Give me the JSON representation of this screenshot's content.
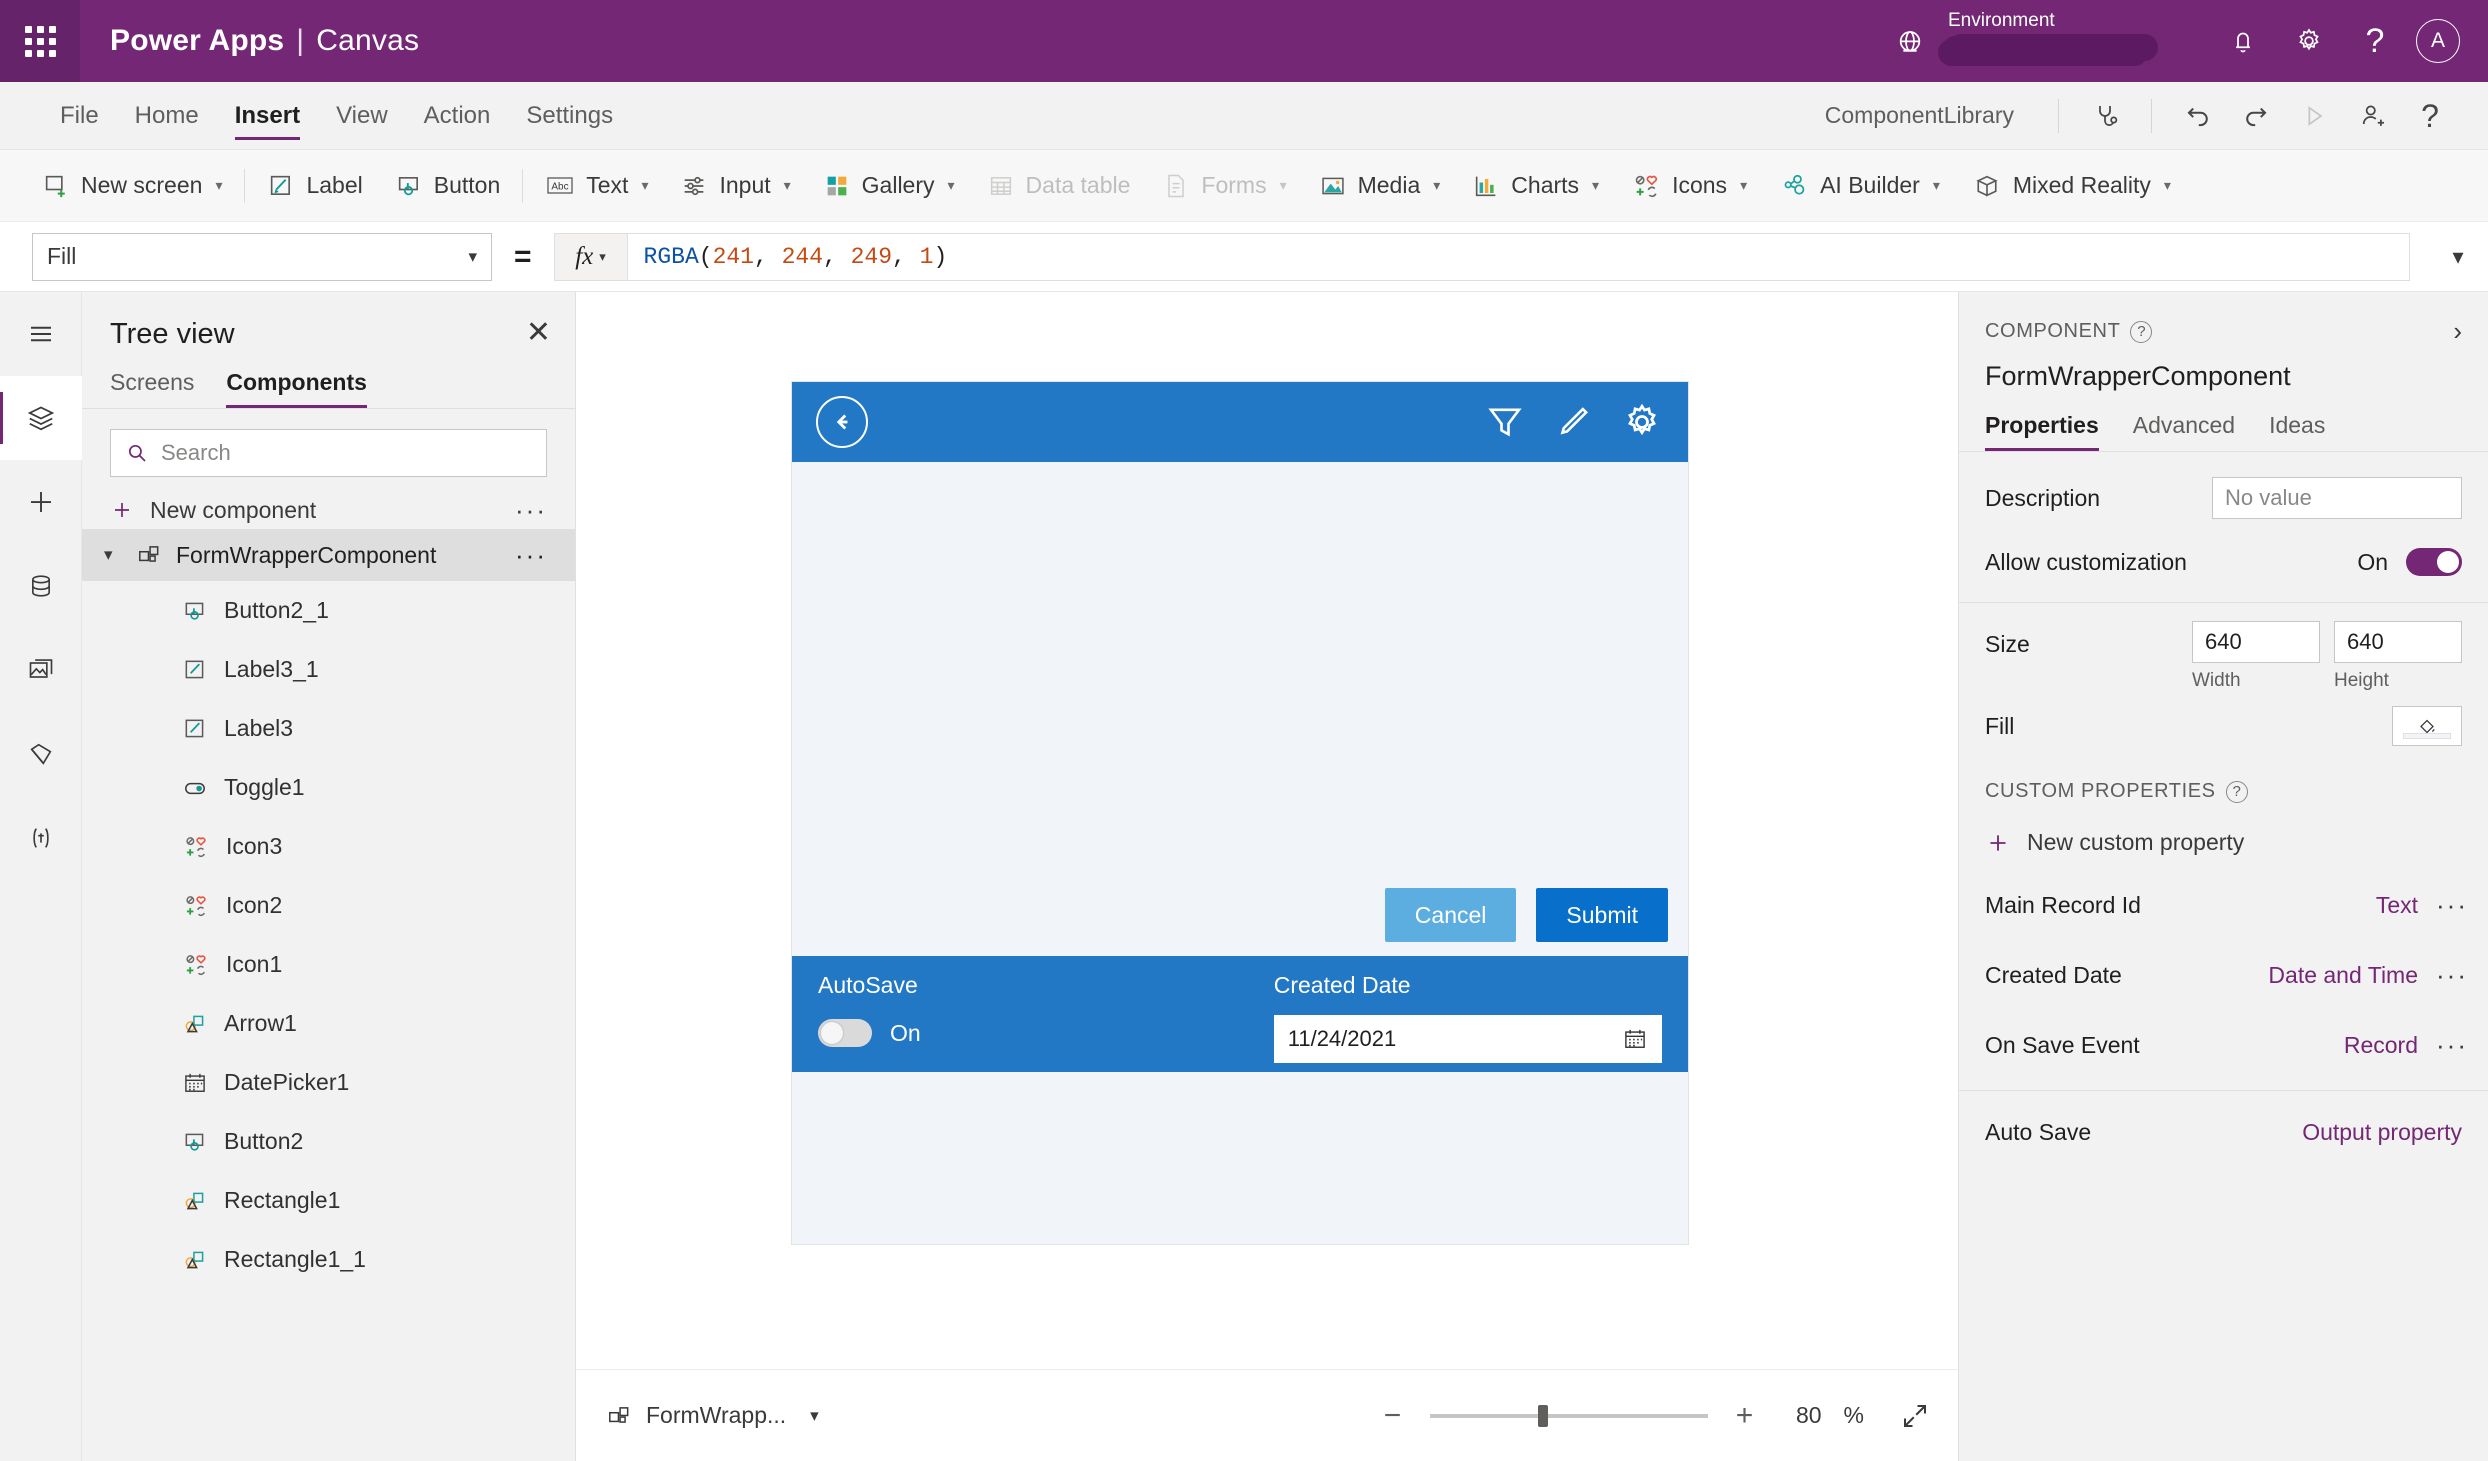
{
  "topbar": {
    "waffle_label": "app-launcher",
    "brand": "Power Apps",
    "separator": "|",
    "sub_brand": "Canvas",
    "environment_label": "Environment",
    "environment_value": "",
    "avatar_initial": "A",
    "icons": [
      "globe-icon",
      "bell-icon",
      "gear-icon",
      "help-icon"
    ]
  },
  "menubar": {
    "items": [
      {
        "label": "File",
        "active": false
      },
      {
        "label": "Home",
        "active": false
      },
      {
        "label": "Insert",
        "active": true
      },
      {
        "label": "View",
        "active": false
      },
      {
        "label": "Action",
        "active": false
      },
      {
        "label": "Settings",
        "active": false
      }
    ],
    "library_name": "ComponentLibrary",
    "right_icons": [
      "app-checker-icon",
      "undo-icon",
      "redo-icon",
      "play-icon",
      "share-icon",
      "help-icon"
    ]
  },
  "ribbon": {
    "items": [
      {
        "label": "New screen",
        "icon": "new-screen-icon",
        "chevron": true,
        "disabled": false
      },
      {
        "label": "Label",
        "icon": "label-icon",
        "chevron": false,
        "disabled": false
      },
      {
        "label": "Button",
        "icon": "button-icon",
        "chevron": false,
        "disabled": false
      },
      {
        "label": "Text",
        "icon": "text-abc-icon",
        "chevron": true,
        "disabled": false
      },
      {
        "label": "Input",
        "icon": "input-sliders-icon",
        "chevron": true,
        "disabled": false
      },
      {
        "label": "Gallery",
        "icon": "gallery-icon",
        "chevron": true,
        "disabled": false
      },
      {
        "label": "Data table",
        "icon": "data-table-icon",
        "chevron": false,
        "disabled": true
      },
      {
        "label": "Forms",
        "icon": "forms-icon",
        "chevron": true,
        "disabled": true
      },
      {
        "label": "Media",
        "icon": "media-image-icon",
        "chevron": true,
        "disabled": false
      },
      {
        "label": "Charts",
        "icon": "charts-bar-icon",
        "chevron": true,
        "disabled": false
      },
      {
        "label": "Icons",
        "icon": "icons-collection-icon",
        "chevron": true,
        "disabled": false
      },
      {
        "label": "AI Builder",
        "icon": "ai-builder-icon",
        "chevron": true,
        "disabled": false
      },
      {
        "label": "Mixed Reality",
        "icon": "mixed-reality-icon",
        "chevron": true,
        "disabled": false
      }
    ]
  },
  "formula_bar": {
    "property_selected": "Fill",
    "equals": "=",
    "fx_label": "fx",
    "formula_parts": [
      {
        "text": "RGBA",
        "color": "#0c51a4"
      },
      {
        "text": "(",
        "color": "#201f1e"
      },
      {
        "text": "241",
        "color": "#c44a11"
      },
      {
        "text": ", ",
        "color": "#201f1e"
      },
      {
        "text": "244",
        "color": "#c44a11"
      },
      {
        "text": ", ",
        "color": "#201f1e"
      },
      {
        "text": "249",
        "color": "#c44a11"
      },
      {
        "text": ", ",
        "color": "#201f1e"
      },
      {
        "text": "1",
        "color": "#c44a11"
      },
      {
        "text": ")",
        "color": "#201f1e"
      }
    ]
  },
  "rail": {
    "items": [
      {
        "icon": "hamburger-menu-icon",
        "selected": false
      },
      {
        "icon": "tree-view-layers-icon",
        "selected": true
      },
      {
        "icon": "insert-plus-icon",
        "selected": false
      },
      {
        "icon": "data-cylinder-icon",
        "selected": false
      },
      {
        "icon": "media-library-icon",
        "selected": false
      },
      {
        "icon": "power-automate-icon",
        "selected": false
      },
      {
        "icon": "variables-icon",
        "selected": false
      }
    ]
  },
  "treeview": {
    "title": "Tree view",
    "close_label": "✕",
    "tabs": [
      {
        "label": "Screens",
        "active": false
      },
      {
        "label": "Components",
        "active": true
      }
    ],
    "search_placeholder": "Search",
    "search_value": "",
    "new_component_label": "New component",
    "overflow_label": "···",
    "root": {
      "label": "FormWrapperComponent",
      "icon": "component-icon",
      "expanded": true
    },
    "children": [
      {
        "label": "Button2_1",
        "icon": "button-icon"
      },
      {
        "label": "Label3_1",
        "icon": "label-icon"
      },
      {
        "label": "Label3",
        "icon": "label-icon"
      },
      {
        "label": "Toggle1",
        "icon": "toggle-icon"
      },
      {
        "label": "Icon3",
        "icon": "icons-collection-icon"
      },
      {
        "label": "Icon2",
        "icon": "icons-collection-icon"
      },
      {
        "label": "Icon1",
        "icon": "icons-collection-icon"
      },
      {
        "label": "Arrow1",
        "icon": "shapes-icon"
      },
      {
        "label": "DatePicker1",
        "icon": "datepicker-calendar-icon"
      },
      {
        "label": "Button2",
        "icon": "button-icon"
      },
      {
        "label": "Rectangle1",
        "icon": "shapes-icon"
      },
      {
        "label": "Rectangle1_1",
        "icon": "shapes-icon"
      }
    ]
  },
  "canvas": {
    "component": {
      "header_icons": [
        "filter-icon",
        "pencil-edit-icon",
        "gear-icon"
      ],
      "back_icon": "back-arrow-icon",
      "cancel_label": "Cancel",
      "submit_label": "Submit",
      "autosave_label": "AutoSave",
      "autosave_state": "On",
      "created_date_label": "Created Date",
      "created_date_value": "11/24/2021",
      "calendar_icon": "calendar-icon"
    },
    "statusbar": {
      "screen_name": "FormWrapp...",
      "zoom_out": "−",
      "zoom_in": "+",
      "zoom_value": "80",
      "zoom_unit": "%",
      "fit_icon": "fit-screen-icon"
    }
  },
  "properties": {
    "kicker": "COMPONENT",
    "help_glyph": "?",
    "collapse_glyph": "›",
    "component_name": "FormWrapperComponent",
    "tabs": [
      {
        "label": "Properties",
        "active": true
      },
      {
        "label": "Advanced",
        "active": false
      },
      {
        "label": "Ideas",
        "active": false
      }
    ],
    "description_label": "Description",
    "description_placeholder": "No value",
    "description_value": "",
    "allow_customization_label": "Allow customization",
    "allow_customization_state": "On",
    "size_label": "Size",
    "width_value": "640",
    "height_value": "640",
    "width_caption": "Width",
    "height_caption": "Height",
    "fill_label": "Fill",
    "custom_properties_title": "CUSTOM PROPERTIES",
    "new_custom_property_label": "New custom property",
    "custom_rows": [
      {
        "name": "Main Record Id",
        "type": "Text",
        "overflow": "···"
      },
      {
        "name": "Created Date",
        "type": "Date and Time",
        "overflow": "···"
      },
      {
        "name": "On Save Event",
        "type": "Record",
        "overflow": "···"
      }
    ],
    "output_row": {
      "name": "Auto Save",
      "type": "Output property"
    }
  },
  "colors": {
    "brand_purple": "#742774",
    "accent_blue": "#2378c6",
    "submit_blue": "#0870ca",
    "cancel_blue": "#5daee0",
    "canvas_fill": "#f1f4f9"
  }
}
